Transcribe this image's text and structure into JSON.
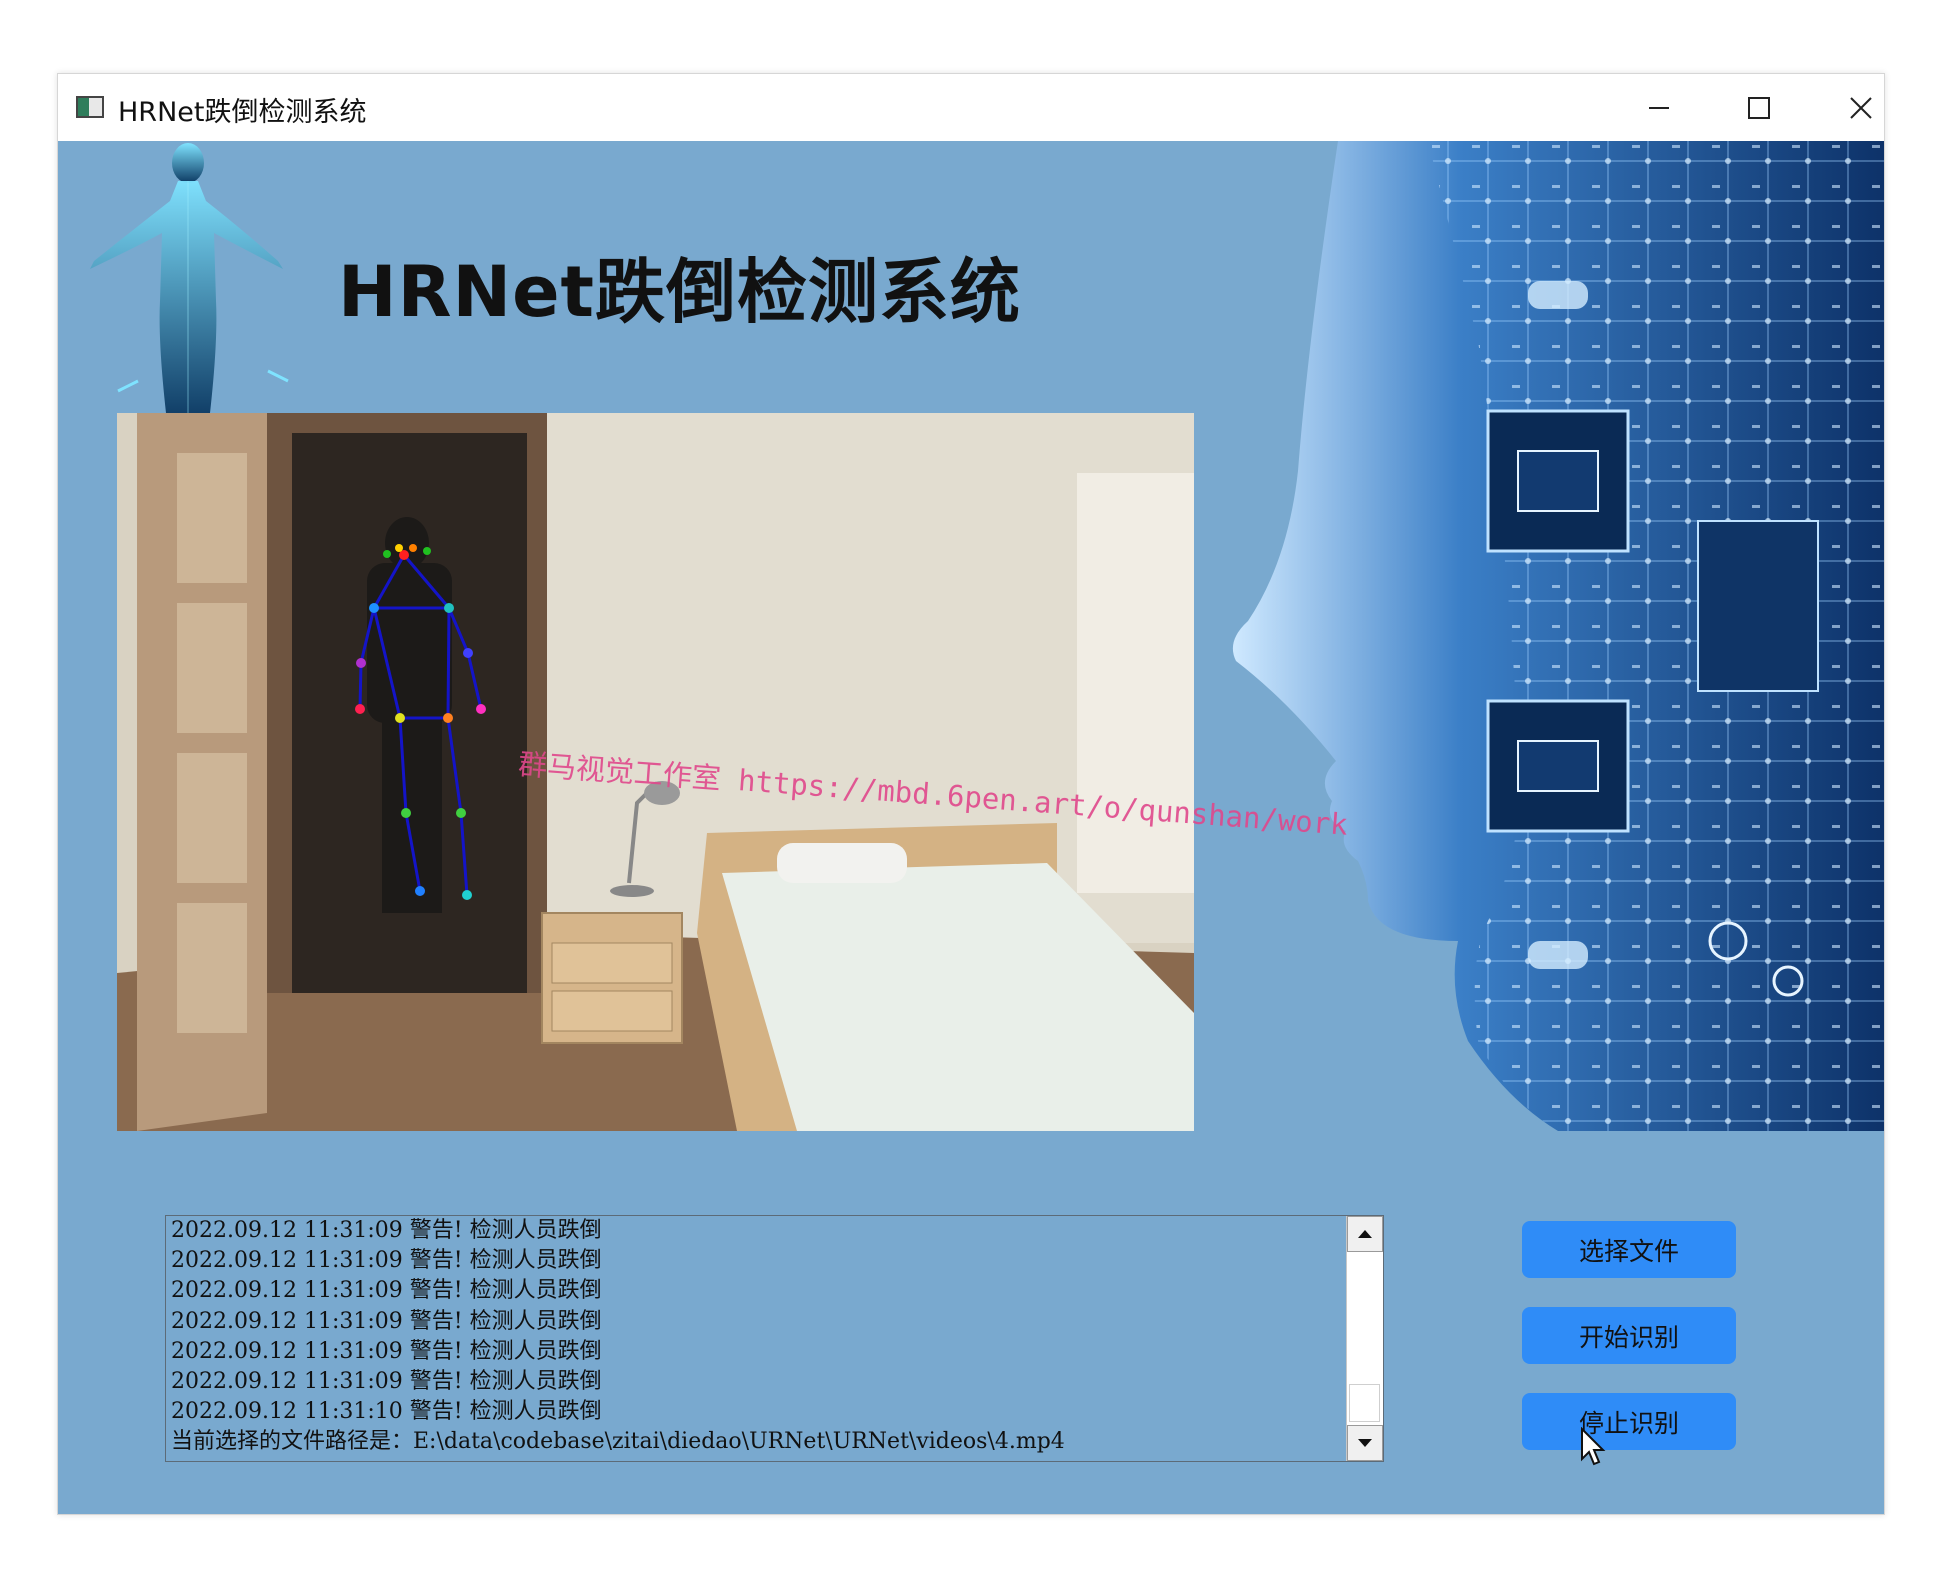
{
  "window": {
    "title": "HRNet跌倒检测系统",
    "controls": [
      "minimize",
      "maximize",
      "close"
    ]
  },
  "app": {
    "heading": "HRNet跌倒检测系统"
  },
  "video": {
    "watermark": "群马视觉工作室 https://mbd.6pen.art/o/qunshan/work",
    "keypoints_shown": true
  },
  "log": {
    "lines": [
      "2022.09.12 11:31:09 警告! 检测人员跌倒",
      "2022.09.12 11:31:09 警告! 检测人员跌倒",
      "2022.09.12 11:31:09 警告! 检测人员跌倒",
      "2022.09.12 11:31:09 警告! 检测人员跌倒",
      "2022.09.12 11:31:09 警告! 检测人员跌倒",
      "2022.09.12 11:31:09 警告! 检测人员跌倒",
      "2022.09.12 11:31:10 警告! 检测人员跌倒",
      "当前选择的文件路径是：E:\\data\\codebase\\zitai\\diedao\\URNet\\URNet\\videos\\4.mp4"
    ]
  },
  "buttons": {
    "select_file": "选择文件",
    "start": "开始识别",
    "stop": "停止识别"
  },
  "colors": {
    "background": "#79a9cf",
    "button": "#2f8cf7",
    "watermark": "#e0488c"
  }
}
